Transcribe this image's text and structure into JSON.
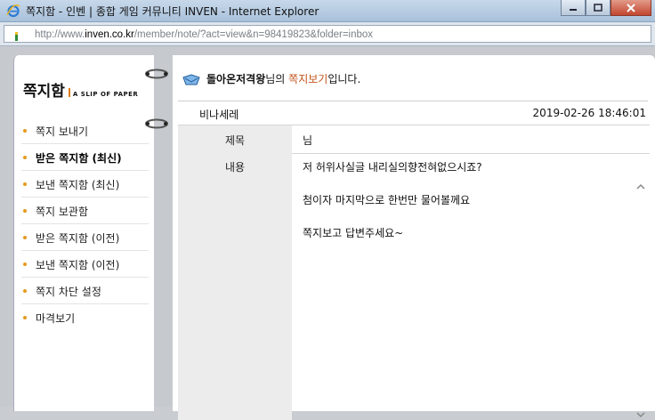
{
  "window": {
    "title": "쪽지함 - 인벤 | 종합 게임 커뮤니티 INVEN - Internet Explorer"
  },
  "address": {
    "prefix": "http://www.",
    "domain": "inven.co.kr",
    "path": "/member/note/?act=view&n=98419823&folder=inbox"
  },
  "sidebar": {
    "logo_kor": "쪽지함",
    "logo_eng": "A SLIP OF PAPER",
    "items": [
      {
        "label": "쪽지 보내기"
      },
      {
        "label": "받은 쪽지함 (최신)"
      },
      {
        "label": "보낸 쪽지함 (최신)"
      },
      {
        "label": "쪽지 보관함"
      },
      {
        "label": "받은 쪽지함 (이전)"
      },
      {
        "label": "보낸 쪽지함 (이전)"
      },
      {
        "label": "쪽지 차단 설정"
      },
      {
        "label": "마격보기"
      }
    ]
  },
  "note": {
    "header_sender": "돌아온저격왕",
    "header_mid": "님의 ",
    "header_link": "쪽지보기",
    "header_end": "입니다.",
    "from": "비나세레",
    "date": "2019-02-26 18:46:01",
    "subject_label": "제목",
    "subject": "님",
    "body_label": "내용",
    "body": {
      "line1": "저 허위사실글 내리실의향전혀없으시죠?",
      "line2": "첨이자 마지막으로 한번만 물어볼께요",
      "line3": "쪽지보고 답변주세요~"
    }
  },
  "colors": {
    "accent_orange": "#c0541b",
    "bullet": "#e59a1d"
  }
}
